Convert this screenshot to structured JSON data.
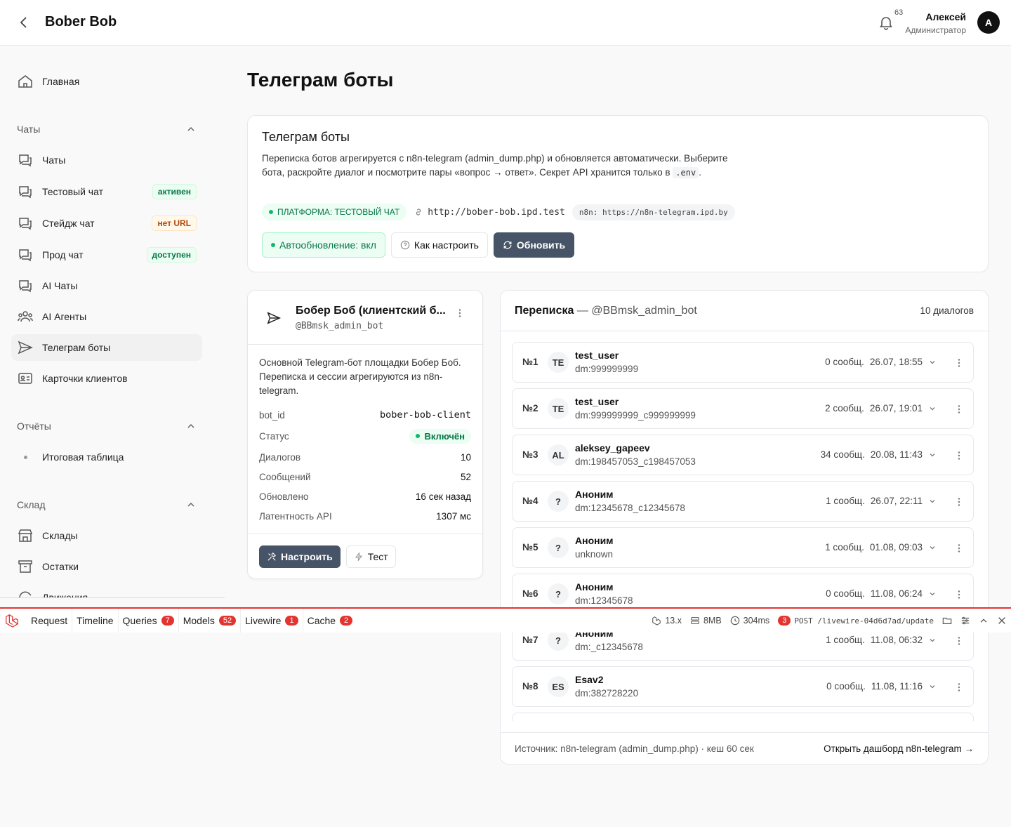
{
  "header": {
    "title": "Bober Bob",
    "notifications_count": "63",
    "user_name": "Алексей",
    "user_role": "Администратор",
    "avatar_letter": "A"
  },
  "sidebar": {
    "home": "Главная",
    "groups": {
      "chats": "Чаты",
      "reports": "Отчёты",
      "warehouse": "Склад"
    },
    "items": [
      {
        "label": "Чаты"
      },
      {
        "label": "Тестовый чат",
        "badge": "активен"
      },
      {
        "label": "Стейдж чат",
        "badge": "нет URL"
      },
      {
        "label": "Прод чат",
        "badge": "доступен"
      },
      {
        "label": "AI Чаты"
      },
      {
        "label": "AI Агенты"
      },
      {
        "label": "Телеграм боты"
      },
      {
        "label": "Карточки клиентов"
      }
    ],
    "reports_items": [
      {
        "label": "Итоговая таблица"
      }
    ],
    "warehouse_items": [
      {
        "label": "Склады"
      },
      {
        "label": "Остатки"
      },
      {
        "label": "Движения"
      }
    ]
  },
  "page": {
    "title": "Телеграм боты"
  },
  "info_card": {
    "title": "Телеграм боты",
    "desc_1": "Переписка ботов агрегируется с n8n-telegram (admin_dump.php) и обновляется автоматически. Выберите бота, раскройте диалог и посмотрите пары «вопрос → ответ». Секрет API хранится только в",
    "desc_code": ".env",
    "desc_end": ".",
    "platform": "ПЛАТФОРМА: ТЕСТОВЫЙ ЧАТ",
    "url": "http://bober-bob.ipd.test",
    "n8n": "n8n: https://n8n-telegram.ipd.by",
    "auto_refresh": "Автообновление: вкл",
    "how_to": "Как настроить",
    "refresh": "Обновить"
  },
  "bot": {
    "name": "Бобер Боб (клиентский б...",
    "handle": "@BBmsk_admin_bot",
    "description": "Основной Telegram-бот площадки Бобер Боб. Переписка и сессии агрегируются из n8n-telegram.",
    "fields": [
      {
        "key": "bot_id",
        "value": "bober-bob-client"
      },
      {
        "key": "Статус",
        "value": "Включён"
      },
      {
        "key": "Диалогов",
        "value": "10"
      },
      {
        "key": "Сообщений",
        "value": "52"
      },
      {
        "key": "Обновлено",
        "value": "16 сек назад"
      },
      {
        "key": "Латентность API",
        "value": "1307 мс"
      }
    ],
    "configure": "Настроить",
    "test": "Тест"
  },
  "dialogs": {
    "title": "Переписка",
    "separator": " — ",
    "handle": "@BBmsk_admin_bot",
    "count": "10 диалогов",
    "rows": [
      {
        "num": "№1",
        "av": "TE",
        "user": "test_user",
        "id": "dm:999999999",
        "msgs": "0 сообщ.",
        "date": "26.07, 18:55"
      },
      {
        "num": "№2",
        "av": "TE",
        "user": "test_user",
        "id": "dm:999999999_c999999999",
        "msgs": "2 сообщ.",
        "date": "26.07, 19:01"
      },
      {
        "num": "№3",
        "av": "AL",
        "user": "aleksey_gapeev",
        "id": "dm:198457053_c198457053",
        "msgs": "34 сообщ.",
        "date": "20.08, 11:43"
      },
      {
        "num": "№4",
        "av": "?",
        "user": "Аноним",
        "id": "dm:12345678_c12345678",
        "msgs": "1 сообщ.",
        "date": "26.07, 22:11"
      },
      {
        "num": "№5",
        "av": "?",
        "user": "Аноним",
        "id": "unknown",
        "msgs": "1 сообщ.",
        "date": "01.08, 09:03"
      },
      {
        "num": "№6",
        "av": "?",
        "user": "Аноним",
        "id": "dm:12345678",
        "msgs": "0 сообщ.",
        "date": "11.08, 06:24"
      },
      {
        "num": "№7",
        "av": "?",
        "user": "Аноним",
        "id": "dm:_c12345678",
        "msgs": "1 сообщ.",
        "date": "11.08, 06:32"
      },
      {
        "num": "№8",
        "av": "ES",
        "user": "Esav2",
        "id": "dm:382728220",
        "msgs": "0 сообщ.",
        "date": "11.08, 11:16"
      }
    ],
    "source": "Источник: n8n-telegram (admin_dump.php) · кеш 60 сек",
    "open_dashboard": "Открыть дашборд n8n-telegram →"
  },
  "debugbar": {
    "tabs": [
      {
        "label": "Request"
      },
      {
        "label": "Timeline"
      },
      {
        "label": "Queries",
        "badge": "7"
      },
      {
        "label": "Models",
        "badge": "52"
      },
      {
        "label": "Livewire",
        "badge": "1"
      },
      {
        "label": "Cache",
        "badge": "2"
      }
    ],
    "version": "13.x",
    "memory": "8MB",
    "time": "304ms",
    "requests_badge": "3",
    "request": "POST /livewire-04d6d7ad/update"
  },
  "colors": {
    "accent_green": "#067647",
    "dark_button": "#475467",
    "debug_red": "#e3342f"
  }
}
